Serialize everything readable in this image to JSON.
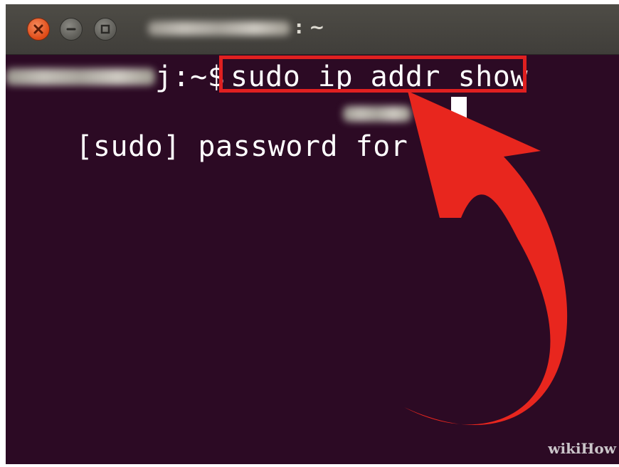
{
  "window": {
    "title_suffix": ": ~",
    "controls": {
      "close_icon": "close-icon",
      "minimize_icon": "minimize-icon",
      "maximize_icon": "maximize-icon"
    }
  },
  "terminal": {
    "prompt_suffix": "j:~$",
    "command": "sudo ip addr show",
    "password_prompt": "[sudo] password for"
  },
  "annotation": {
    "highlight_color": "#e02020",
    "arrow_icon": "curved-arrow-icon"
  },
  "watermark": {
    "text": "wikiHow"
  },
  "colors": {
    "terminal_background": "#2c0a24",
    "titlebar": "#4a4843",
    "close_button": "#e8591d"
  }
}
